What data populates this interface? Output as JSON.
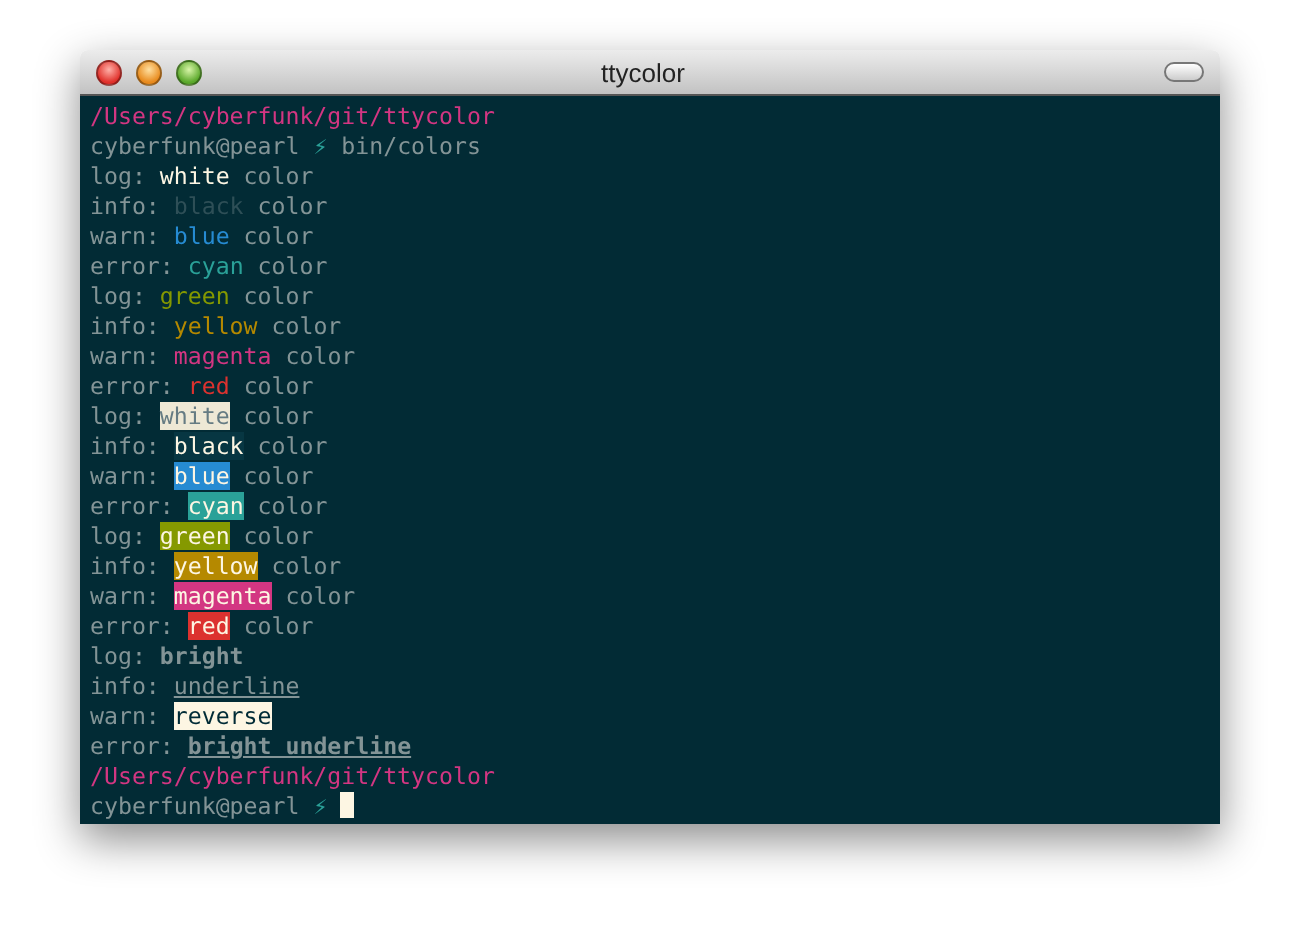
{
  "window": {
    "title": "ttycolor"
  },
  "terminal": {
    "lines": [
      {
        "kind": "path",
        "text": "/Users/cyberfunk/git/ttycolor"
      },
      {
        "kind": "prompt",
        "user": "cyberfunk@pearl",
        "symbol": "⚡",
        "command": "bin/colors"
      },
      {
        "kind": "fg",
        "level": "log:",
        "word": "white",
        "color": "#fdf6e3",
        "suffix": "color"
      },
      {
        "kind": "fg",
        "level": "info:",
        "word": "black",
        "color": "#2e4f57",
        "suffix": "color"
      },
      {
        "kind": "fg",
        "level": "warn:",
        "word": "blue",
        "color": "#268bd2",
        "suffix": "color"
      },
      {
        "kind": "fg",
        "level": "error:",
        "word": "cyan",
        "color": "#2aa198",
        "suffix": "color"
      },
      {
        "kind": "fg",
        "level": "log:",
        "word": "green",
        "color": "#859900",
        "suffix": "color"
      },
      {
        "kind": "fg",
        "level": "info:",
        "word": "yellow",
        "color": "#b58900",
        "suffix": "color"
      },
      {
        "kind": "fg",
        "level": "warn:",
        "word": "magenta",
        "color": "#d33682",
        "suffix": "color"
      },
      {
        "kind": "fg",
        "level": "error:",
        "word": "red",
        "color": "#dc322f",
        "suffix": "color"
      },
      {
        "kind": "bg",
        "level": "log:",
        "word": "white",
        "color": "#eee8d5",
        "suffix": "color"
      },
      {
        "kind": "bg",
        "level": "info:",
        "word": "black",
        "color": "#073642",
        "suffix": "color"
      },
      {
        "kind": "bg",
        "level": "warn:",
        "word": "blue",
        "color": "#268bd2",
        "suffix": "color"
      },
      {
        "kind": "bg",
        "level": "error:",
        "word": "cyan",
        "color": "#2aa198",
        "suffix": "color"
      },
      {
        "kind": "bg",
        "level": "log:",
        "word": "green",
        "color": "#859900",
        "suffix": "color"
      },
      {
        "kind": "bg",
        "level": "info:",
        "word": "yellow",
        "color": "#b58900",
        "suffix": "color"
      },
      {
        "kind": "bg",
        "level": "warn:",
        "word": "magenta",
        "color": "#d33682",
        "suffix": "color"
      },
      {
        "kind": "bg",
        "level": "error:",
        "word": "red",
        "color": "#dc322f",
        "suffix": "color"
      },
      {
        "kind": "bright",
        "level": "log:",
        "word": "bright"
      },
      {
        "kind": "underline",
        "level": "info:",
        "word": "underline"
      },
      {
        "kind": "reverse",
        "level": "warn:",
        "word": "reverse"
      },
      {
        "kind": "bright_underline",
        "level": "error:",
        "word": "bright underline"
      },
      {
        "kind": "path",
        "text": "/Users/cyberfunk/git/ttycolor"
      },
      {
        "kind": "prompt",
        "user": "cyberfunk@pearl",
        "symbol": "⚡",
        "cursor": true
      }
    ]
  }
}
